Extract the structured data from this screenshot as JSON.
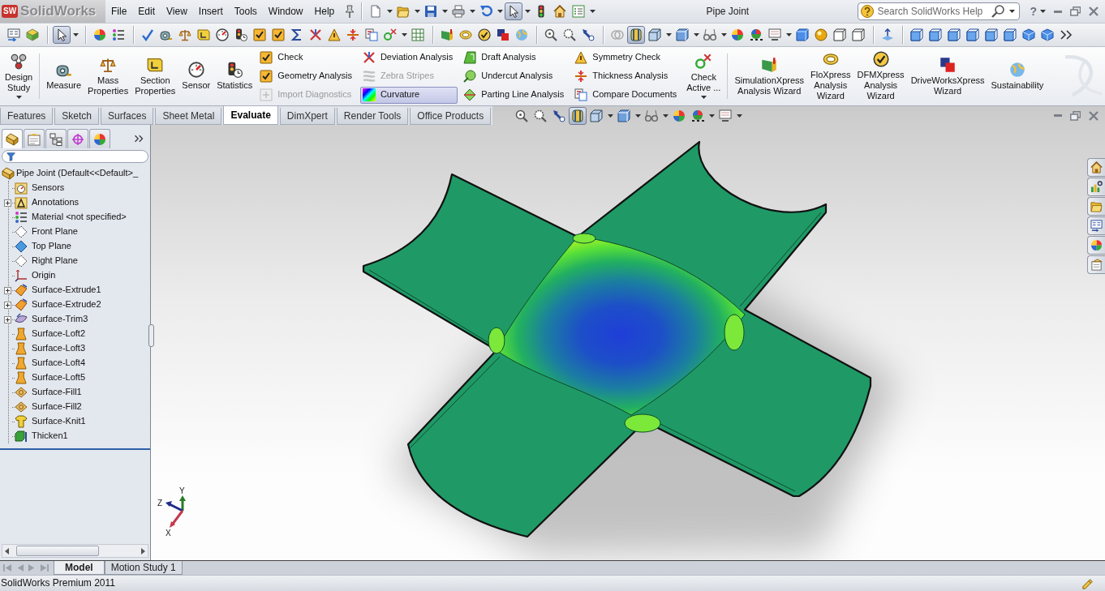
{
  "title_bar": {
    "logo_badge": "SW",
    "logo_text": "SolidWorks",
    "menus": [
      "File",
      "Edit",
      "View",
      "Insert",
      "Tools",
      "Window",
      "Help"
    ],
    "quick_access": [
      {
        "pressed": false
      },
      {
        "pressed": false
      },
      {
        "pressed": false
      },
      {
        "pressed": false
      },
      {
        "pressed": false
      },
      {
        "pressed": true
      },
      {
        "pressed": false
      },
      {
        "pressed": false
      },
      {
        "pressed": false
      }
    ],
    "document_title": "Pipe Joint",
    "search": {
      "placeholder": "Search SolidWorks Help"
    },
    "help_button": "?"
  },
  "standard_toolbar": [
    {
      "pressed": false
    },
    {
      "pressed": false
    },
    {
      "pressed": true
    },
    {
      "pressed": false
    },
    {
      "pressed": false
    },
    {
      "pressed": false
    },
    {
      "pressed": false
    },
    {
      "pressed": false
    },
    {
      "pressed": false
    },
    {
      "pressed": false
    },
    {
      "pressed": false
    },
    {
      "pressed": false
    },
    {
      "pressed": false
    },
    {
      "pressed": false
    },
    {
      "pressed": false
    },
    {
      "pressed": false
    },
    {
      "pressed": false
    },
    {
      "pressed": false
    },
    {
      "pressed": false
    },
    {
      "pressed": false
    },
    {
      "pressed": false
    },
    {
      "pressed": false
    },
    {
      "pressed": false
    },
    {
      "pressed": false
    },
    {
      "pressed": false
    },
    {
      "pressed": false
    },
    {
      "pressed": false
    },
    {
      "pressed": false
    },
    {
      "pressed": false
    },
    {
      "pressed": true
    },
    {
      "pressed": false
    },
    {
      "pressed": false
    },
    {
      "pressed": false
    },
    {
      "pressed": false
    },
    {
      "pressed": false
    },
    {
      "pressed": false
    },
    {
      "pressed": false
    },
    {
      "pressed": false
    },
    {
      "pressed": false
    },
    {
      "pressed": false
    },
    {
      "pressed": false
    },
    {
      "pressed": false
    },
    {
      "pressed": false
    },
    {
      "pressed": false
    },
    {
      "pressed": false
    },
    {
      "pressed": false
    },
    {
      "pressed": false
    },
    {
      "pressed": false
    },
    {
      "pressed": false
    },
    {
      "pressed": false
    }
  ],
  "ribbon": {
    "items": [
      {
        "kind": "large",
        "label": "Design\nStudy",
        "menu": true
      },
      {
        "kind": "separator"
      },
      {
        "kind": "large",
        "label": "Measure",
        "menu": false
      },
      {
        "kind": "large",
        "label": "Mass\nProperties",
        "menu": false
      },
      {
        "kind": "large",
        "label": "Section\nProperties",
        "menu": false
      },
      {
        "kind": "large",
        "label": "Sensor",
        "menu": false
      },
      {
        "kind": "large",
        "label": "Statistics",
        "menu": false
      },
      {
        "kind": "column",
        "buttons": [
          {
            "label": "Check",
            "disabled": false,
            "on": false
          },
          {
            "label": "Geometry Analysis",
            "disabled": false,
            "on": false
          },
          {
            "label": "Import Diagnostics",
            "disabled": true,
            "on": false
          }
        ]
      },
      {
        "kind": "column",
        "buttons": [
          {
            "label": "Deviation Analysis",
            "disabled": false,
            "on": false
          },
          {
            "label": "Zebra Stripes",
            "disabled": true,
            "on": false
          },
          {
            "label": "Curvature",
            "disabled": false,
            "on": true
          }
        ]
      },
      {
        "kind": "column",
        "buttons": [
          {
            "label": "Draft Analysis",
            "disabled": false,
            "on": false
          },
          {
            "label": "Undercut Analysis",
            "disabled": false,
            "on": false
          },
          {
            "label": "Parting Line Analysis",
            "disabled": false,
            "on": false
          }
        ]
      },
      {
        "kind": "column",
        "buttons": [
          {
            "label": "Symmetry Check",
            "disabled": false,
            "on": false
          },
          {
            "label": "Thickness Analysis",
            "disabled": false,
            "on": false
          },
          {
            "label": "Compare Documents",
            "disabled": false,
            "on": false
          }
        ]
      },
      {
        "kind": "large",
        "label": "Check\nActive ...",
        "menu": true
      },
      {
        "kind": "separator"
      },
      {
        "kind": "large",
        "label": "SimulationXpress\nAnalysis Wizard",
        "menu": false
      },
      {
        "kind": "large",
        "label": "FloXpress\nAnalysis\nWizard",
        "menu": false
      },
      {
        "kind": "large",
        "label": "DFMXpress\nAnalysis\nWizard",
        "menu": false
      },
      {
        "kind": "large",
        "label": "DriveWorksXpress\nWizard",
        "menu": false
      },
      {
        "kind": "large",
        "label": "Sustainability",
        "menu": false
      }
    ]
  },
  "command_tabs": [
    {
      "label": "Features",
      "selected": false
    },
    {
      "label": "Sketch",
      "selected": false
    },
    {
      "label": "Surfaces",
      "selected": false
    },
    {
      "label": "Sheet Metal",
      "selected": false
    },
    {
      "label": "Evaluate",
      "selected": true
    },
    {
      "label": "DimXpert",
      "selected": false
    },
    {
      "label": "Render Tools",
      "selected": false
    },
    {
      "label": "Office Products",
      "selected": false
    }
  ],
  "heads_up_toolbar": [
    {
      "pressed": false
    },
    {
      "pressed": false
    },
    {
      "pressed": false
    },
    {
      "pressed": true
    },
    {
      "pressed": false
    },
    {
      "pressed": false
    },
    {
      "pressed": false
    },
    {
      "pressed": false
    },
    {
      "pressed": false
    },
    {
      "pressed": false
    }
  ],
  "feature_manager": {
    "panel_tabs": [
      {
        "selected": true
      },
      {
        "selected": false
      },
      {
        "selected": false
      },
      {
        "selected": false
      },
      {
        "selected": false
      }
    ],
    "tree": {
      "label": "Pipe Joint (Default<<Default>_",
      "children": [
        {
          "label": "Sensors",
          "collapsed": false
        },
        {
          "label": "Annotations",
          "collapsed": true
        },
        {
          "label": "Material <not specified>",
          "collapsed": false
        },
        {
          "label": "Front Plane",
          "collapsed": false
        },
        {
          "label": "Top Plane",
          "collapsed": false
        },
        {
          "label": "Right Plane",
          "collapsed": false
        },
        {
          "label": "Origin",
          "collapsed": false
        },
        {
          "label": "Surface-Extrude1",
          "collapsed": true
        },
        {
          "label": "Surface-Extrude2",
          "collapsed": true
        },
        {
          "label": "Surface-Trim3",
          "collapsed": true
        },
        {
          "label": "Surface-Loft2",
          "collapsed": false
        },
        {
          "label": "Surface-Loft3",
          "collapsed": false
        },
        {
          "label": "Surface-Loft4",
          "collapsed": false
        },
        {
          "label": "Surface-Loft5",
          "collapsed": false
        },
        {
          "label": "Surface-Fill1",
          "collapsed": false
        },
        {
          "label": "Surface-Fill2",
          "collapsed": false
        },
        {
          "label": "Surface-Knit1",
          "collapsed": false
        },
        {
          "label": "Thicken1",
          "collapsed": false
        }
      ]
    }
  },
  "viewport": {
    "axis_labels": {
      "y": "Y",
      "z": "Z",
      "x": "X"
    }
  },
  "model_tabs": [
    {
      "label": "Model",
      "selected": true
    },
    {
      "label": "Motion Study 1",
      "selected": false
    }
  ],
  "status_bar": {
    "text": "SolidWorks Premium 2011"
  }
}
